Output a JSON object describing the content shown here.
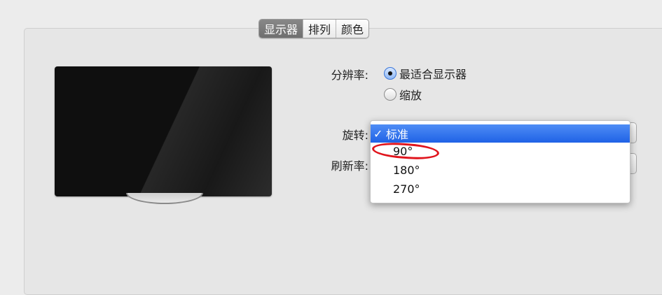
{
  "tabs": [
    {
      "label": "显示器",
      "active": true
    },
    {
      "label": "排列",
      "active": false
    },
    {
      "label": "颜色",
      "active": false
    }
  ],
  "resolution": {
    "label": "分辨率:",
    "options": [
      {
        "label": "最适合显示器",
        "selected": true
      },
      {
        "label": "缩放",
        "selected": false
      }
    ]
  },
  "rotation": {
    "label": "旋转:",
    "menu_items": [
      {
        "check": "✓",
        "label": "标准",
        "selected": true
      },
      {
        "check": "",
        "label": "90°",
        "selected": false
      },
      {
        "check": "",
        "label": "180°",
        "selected": false
      },
      {
        "check": "",
        "label": "270°",
        "selected": false
      }
    ]
  },
  "refresh": {
    "label": "刷新率:"
  },
  "colors": {
    "selection": "#2f6fe8",
    "annotation": "#e0141c"
  }
}
